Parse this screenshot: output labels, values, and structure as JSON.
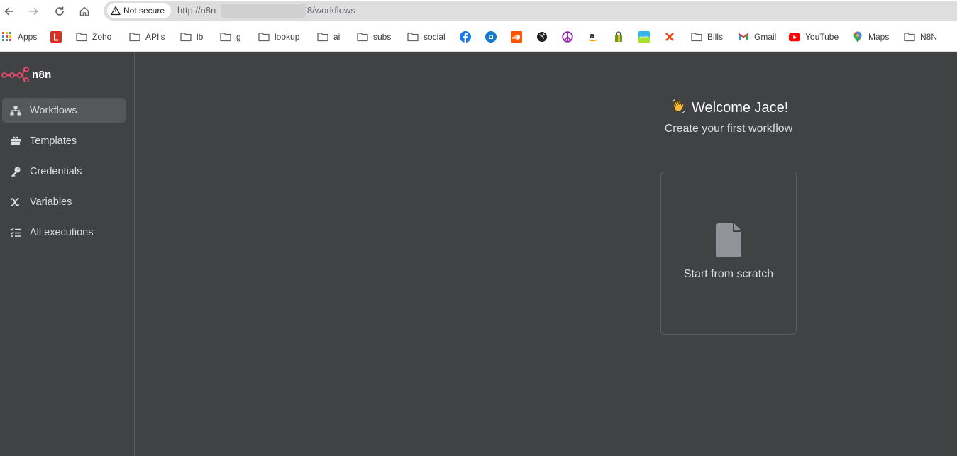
{
  "browser": {
    "security_label": "Not secure",
    "url_prefix": "http://n8n",
    "url_suffix": "5678/workflows"
  },
  "bookmarks": [
    {
      "label": "Apps",
      "icon": "apps-grid-icon"
    },
    {
      "label": "",
      "icon": "red-l-icon"
    },
    {
      "label": "Zoho",
      "icon": "folder-icon"
    },
    {
      "label": "API's",
      "icon": "folder-icon"
    },
    {
      "label": "lb",
      "icon": "folder-icon"
    },
    {
      "label": "g",
      "icon": "folder-icon"
    },
    {
      "label": "lookup",
      "icon": "folder-icon"
    },
    {
      "label": "ai",
      "icon": "folder-icon"
    },
    {
      "label": "subs",
      "icon": "folder-icon"
    },
    {
      "label": "social",
      "icon": "folder-icon"
    },
    {
      "label": "",
      "icon": "facebook-icon"
    },
    {
      "label": "",
      "icon": "chase-icon"
    },
    {
      "label": "",
      "icon": "soundcloud-icon"
    },
    {
      "label": "",
      "icon": "globe-icon"
    },
    {
      "label": "",
      "icon": "peace-icon"
    },
    {
      "label": "",
      "icon": "amazon-icon"
    },
    {
      "label": "",
      "icon": "shopping-bag-icon"
    },
    {
      "label": "",
      "icon": "wish-icon"
    },
    {
      "label": "",
      "icon": "x-red-icon"
    },
    {
      "label": "Bills",
      "icon": "folder-icon"
    },
    {
      "label": "Gmail",
      "icon": "gmail-icon"
    },
    {
      "label": "YouTube",
      "icon": "youtube-icon"
    },
    {
      "label": "Maps",
      "icon": "maps-pin-icon"
    },
    {
      "label": "N8N",
      "icon": "folder-icon"
    }
  ],
  "app": {
    "logo_text": "n8n",
    "accent": "#ea4b71"
  },
  "sidebar": {
    "items": [
      {
        "label": "Workflows",
        "icon": "workflows-icon",
        "active": true
      },
      {
        "label": "Templates",
        "icon": "templates-icon",
        "active": false
      },
      {
        "label": "Credentials",
        "icon": "key-icon",
        "active": false
      },
      {
        "label": "Variables",
        "icon": "variable-icon",
        "active": false
      },
      {
        "label": "All executions",
        "icon": "executions-list-icon",
        "active": false
      }
    ]
  },
  "main": {
    "welcome": "Welcome Jace!",
    "subtitle": "Create your first workflow",
    "card_label": "Start from scratch"
  }
}
